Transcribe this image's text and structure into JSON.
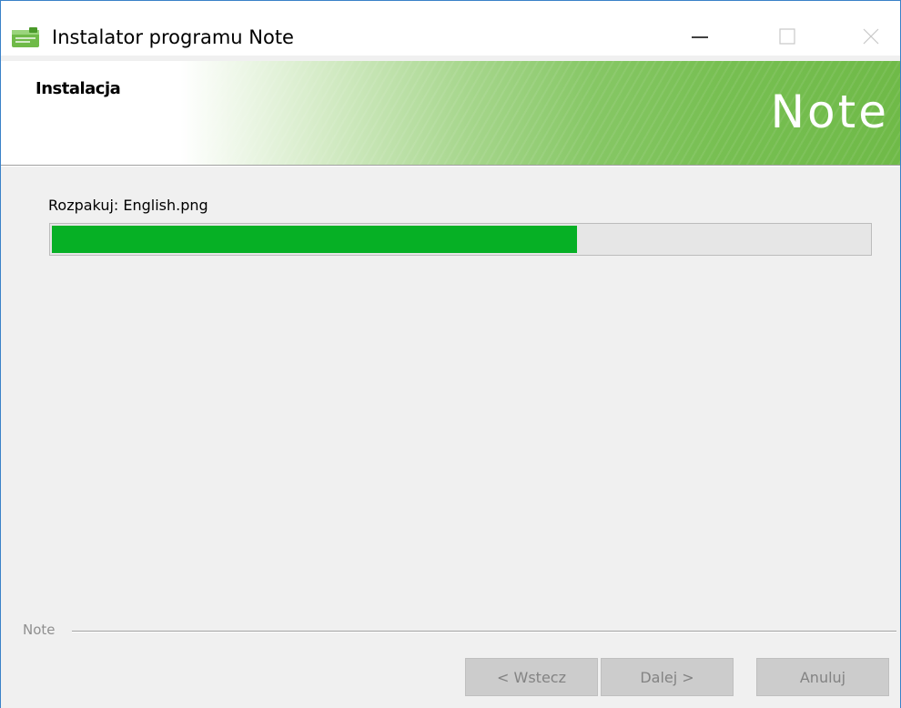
{
  "window": {
    "title": "Instalator programu Note",
    "controls": {
      "minimize_icon": "minimize-icon",
      "maximize_icon": "maximize-icon",
      "close_icon": "close-icon"
    }
  },
  "header": {
    "title": "Instalacja",
    "logo": "Note",
    "accent_color": "#6fba48"
  },
  "content": {
    "status_text": "Rozpakuj: English.png",
    "progress_percent": 64.3,
    "progress_color": "#06b025"
  },
  "footer": {
    "branding": "Note",
    "buttons": {
      "back": "< Wstecz",
      "next": "Dalej >",
      "cancel": "Anuluj"
    }
  }
}
